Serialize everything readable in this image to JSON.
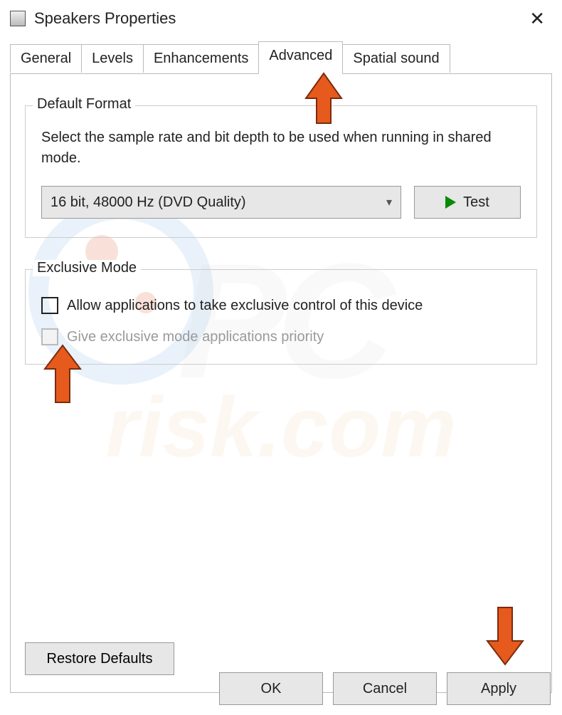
{
  "window": {
    "title": "Speakers Properties"
  },
  "tabs": {
    "general": "General",
    "levels": "Levels",
    "enhancements": "Enhancements",
    "advanced": "Advanced",
    "spatial": "Spatial sound",
    "active": "Advanced"
  },
  "default_format": {
    "title": "Default Format",
    "description": "Select the sample rate and bit depth to be used when running in shared mode.",
    "selected": "16 bit, 48000 Hz (DVD Quality)",
    "test_label": "Test"
  },
  "exclusive_mode": {
    "title": "Exclusive Mode",
    "allow_label": "Allow applications to take exclusive control of this device",
    "allow_checked": false,
    "priority_label": "Give exclusive mode applications priority",
    "priority_enabled": false
  },
  "buttons": {
    "restore": "Restore Defaults",
    "ok": "OK",
    "cancel": "Cancel",
    "apply": "Apply"
  }
}
